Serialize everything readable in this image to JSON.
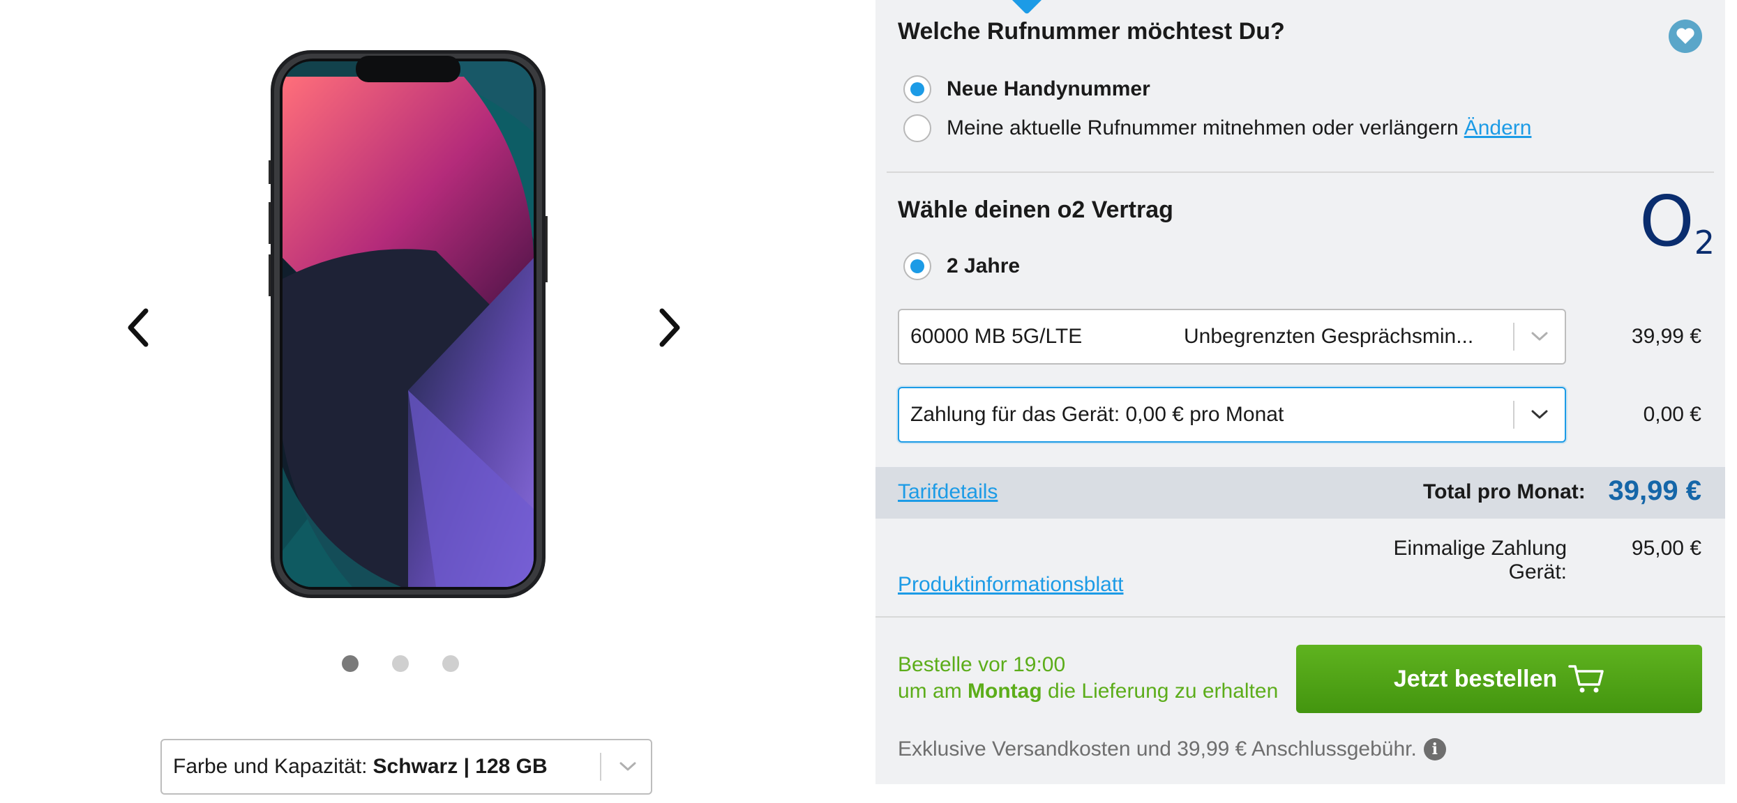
{
  "gallery": {
    "dots": [
      {
        "active": true
      },
      {
        "active": false
      },
      {
        "active": false
      }
    ],
    "variant": {
      "label": "Farbe und Kapazität:",
      "value": "Schwarz | 128 GB"
    }
  },
  "number_section": {
    "title": "Welche Rufnummer möchtest Du?",
    "options": [
      {
        "label": "Neue Handynummer",
        "checked": true
      },
      {
        "label": "Meine aktuelle Rufnummer mitnehmen oder verlängern",
        "checked": false
      }
    ],
    "change_link": "Ändern"
  },
  "contract_section": {
    "title": "Wähle deinen o2 Vertrag",
    "brand": {
      "main": "O",
      "sub": "2"
    },
    "term_option": {
      "label": "2 Jahre",
      "checked": true
    },
    "tariff_dropdown": {
      "data": "60000 MB 5G/LTE",
      "calls": "Unbegrenzten Gesprächsmin...",
      "price": "39,99 €"
    },
    "device_dropdown": {
      "value": "Zahlung für das Gerät: 0,00 € pro Monat",
      "price": "0,00 €"
    }
  },
  "summary": {
    "tariff_details_link": "Tarifdetails",
    "total_label": "Total pro Monat:",
    "total_value": "39,99 €",
    "one_time_label": "Einmalige Zahlung Gerät:",
    "one_time_value": "95,00 €",
    "info_sheet_link": "Produktinformationsblatt"
  },
  "order": {
    "delivery_line1": "Bestelle vor 19:00",
    "delivery_prefix": "um am",
    "delivery_day": "Montag",
    "delivery_suffix": "die Lieferung zu erhalten",
    "button_label": "Jetzt bestellen",
    "footnote": "Exklusive Versandkosten und 39,99 € Anschlussgebühr."
  },
  "colors": {
    "accent": "#1c9be6",
    "order_green": "#4ea516",
    "total_blue": "#1566a8",
    "brand_navy": "#0a2d6e"
  }
}
